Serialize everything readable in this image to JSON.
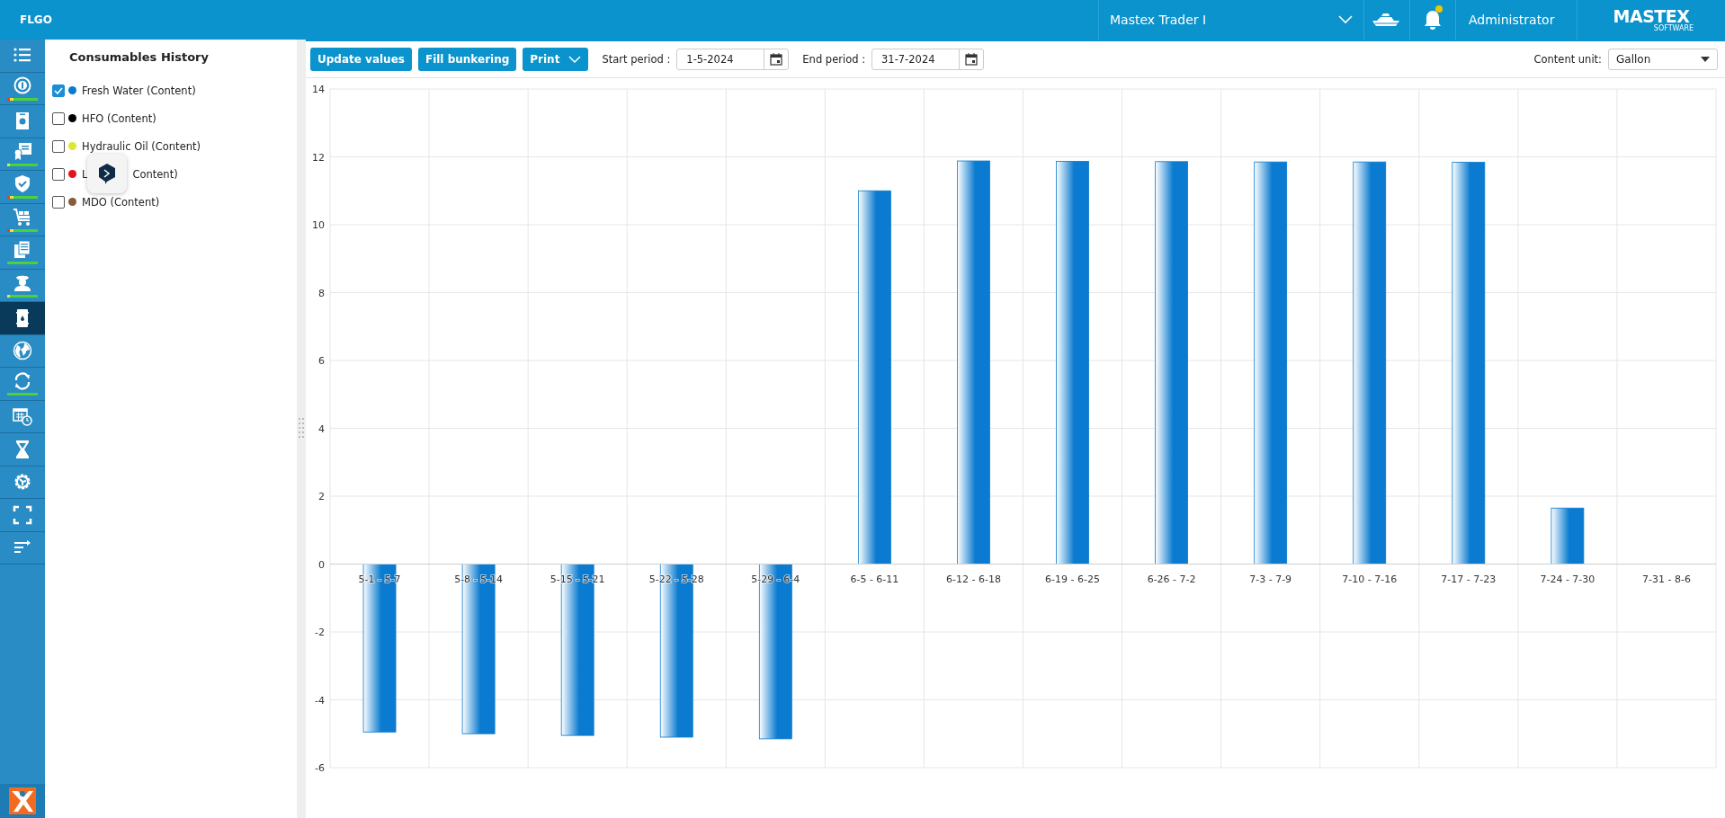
{
  "app_bar": {
    "app_name": "FLGO",
    "vessel": "Mastex Trader I",
    "user": "Administrator",
    "logo": {
      "name": "MASTEX",
      "tagline": "SOFTWARE"
    },
    "notification": true
  },
  "nav": [
    {
      "selected": false
    },
    {
      "status": [
        {
          "color": "#e53935",
          "level": 0.08
        },
        {
          "color": "#f2e22e",
          "level": 0.12
        },
        {
          "color": "#4cd137",
          "level": 0.8
        }
      ],
      "selected": false
    },
    {
      "selected": false
    },
    {
      "status": [
        {
          "color": "#f2e22e",
          "level": 0.1
        },
        {
          "color": "#4cd137",
          "level": 0.9
        }
      ],
      "selected": false
    },
    {
      "status": [
        {
          "color": "#e53935",
          "level": 0.08
        },
        {
          "color": "#f2e22e",
          "level": 0.12
        },
        {
          "color": "#4cd137",
          "level": 0.8
        }
      ],
      "selected": false
    },
    {
      "status": [
        {
          "color": "#e53935",
          "level": 0.08
        },
        {
          "color": "#f2e22e",
          "level": 0.12
        },
        {
          "color": "#4cd137",
          "level": 0.8
        }
      ],
      "selected": false
    },
    {
      "status": [
        {
          "color": "#4cd137",
          "level": 1
        }
      ],
      "selected": false
    },
    {
      "status": [
        {
          "color": "#f2e22e",
          "level": 0.1
        },
        {
          "color": "#4cd137",
          "level": 0.9
        }
      ],
      "selected": false
    },
    {
      "selected": true
    },
    {
      "selected": false
    },
    {
      "status": [
        {
          "color": "#4cd137",
          "level": 1
        }
      ],
      "selected": false
    },
    {
      "selected": false
    },
    {
      "selected": false
    },
    {
      "selected": false
    },
    {
      "selected": false
    },
    {
      "selected": false
    }
  ],
  "legend": {
    "title": "Consumables History",
    "items": [
      {
        "label": "Fresh Water (Content)",
        "color": "#0a7bd0",
        "checked": true
      },
      {
        "label": "HFO (Content)",
        "color": "#000000",
        "checked": false
      },
      {
        "label": "Hydraulic Oil (Content)",
        "color": "#dce635",
        "checked": false
      },
      {
        "label": "L",
        "label_tail": "Content)",
        "color": "#e8101c",
        "checked": false
      },
      {
        "label": "MDO (Content)",
        "color": "#8a5a3a",
        "checked": false
      }
    ]
  },
  "toolbar": {
    "buttons": [
      {
        "label": "Update values"
      },
      {
        "label": "Fill bunkering"
      },
      {
        "label": "Print",
        "dropdown": true
      }
    ],
    "start_period": {
      "label": "Start period :",
      "value": "1-5-2024"
    },
    "end_period": {
      "label": "End period :",
      "value": "31-7-2024"
    },
    "content_unit": {
      "label": "Content unit:",
      "value": "Gallon"
    }
  },
  "chart_data": {
    "type": "bar",
    "grid": true,
    "categories": [
      "5-1 - 5-7",
      "5-8 - 5-14",
      "5-15 - 5-21",
      "5-22 - 5-28",
      "5-29 - 6-4",
      "6-5 - 6-11",
      "6-12 - 6-18",
      "6-19 - 6-25",
      "6-26 - 7-2",
      "7-3 - 7-9",
      "7-10 - 7-16",
      "7-17 - 7-23",
      "7-24 - 7-30",
      "7-31 - 8-6"
    ],
    "series": [
      {
        "color": "#0a7bd0",
        "values": [
          -4.95,
          -5.0,
          -5.05,
          -5.1,
          -5.15,
          11.0,
          11.88,
          11.87,
          11.86,
          11.85,
          11.85,
          11.84,
          1.65,
          null
        ]
      }
    ],
    "ylim": [
      -6,
      14
    ],
    "yticks": [
      -6,
      -4,
      -2,
      0,
      2,
      4,
      6,
      8,
      10,
      12,
      14
    ]
  }
}
